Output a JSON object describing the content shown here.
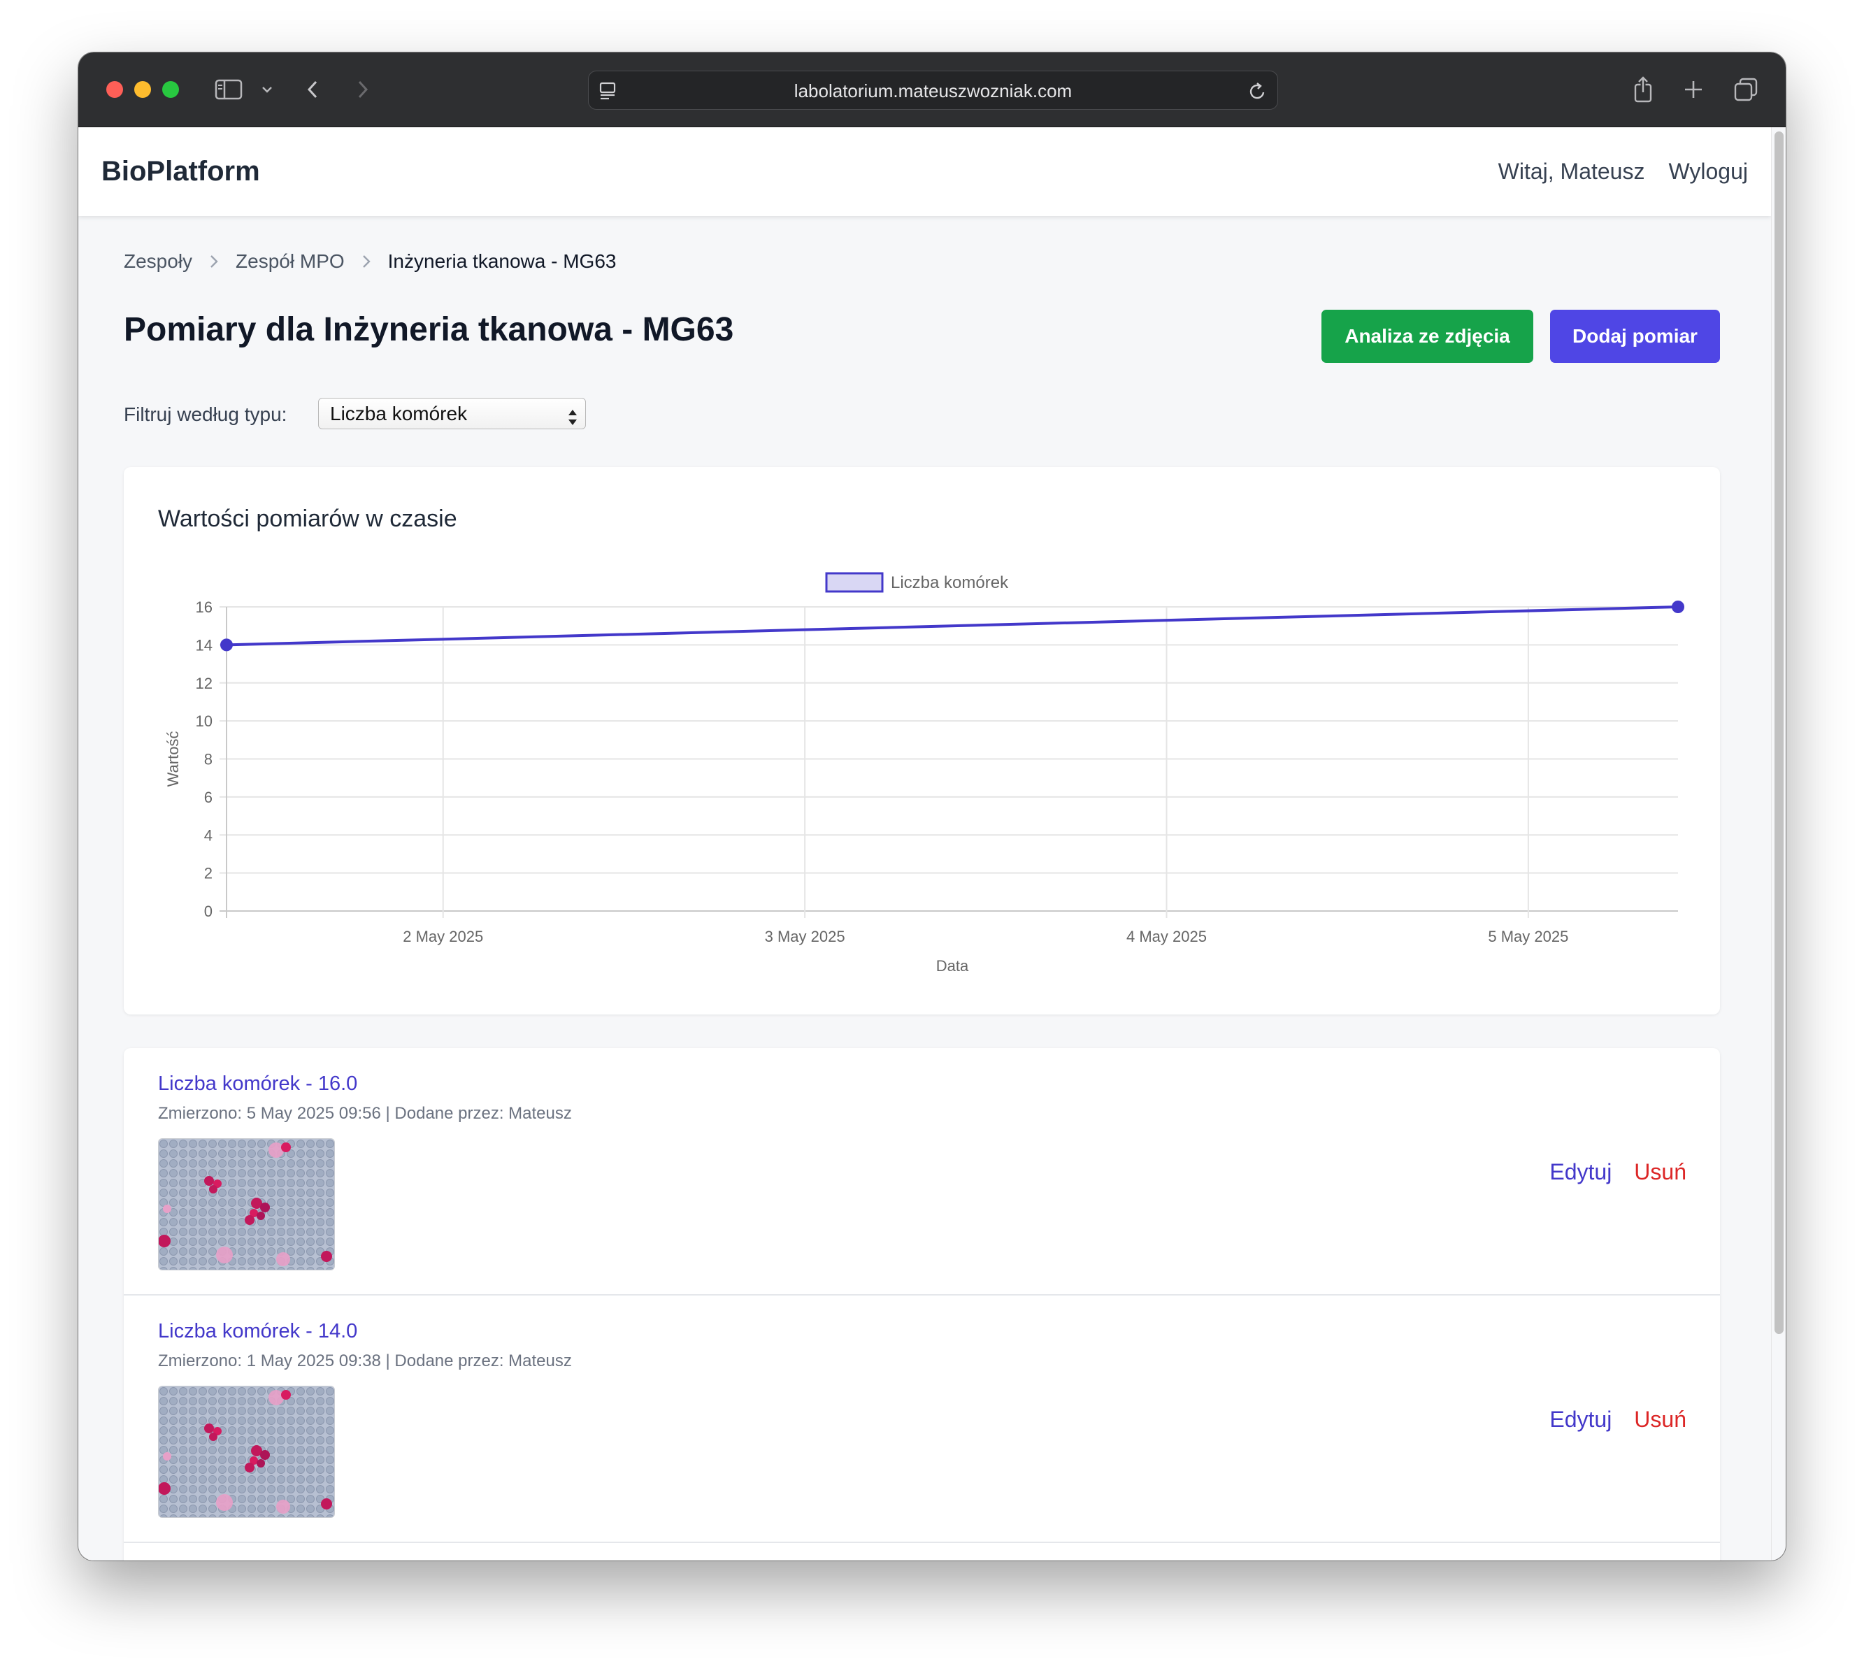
{
  "browser": {
    "url": "labolatorium.mateuszwozniak.com"
  },
  "navbar": {
    "brand": "BioPlatform",
    "greeting": "Witaj, Mateusz",
    "logout": "Wyloguj"
  },
  "breadcrumb": {
    "items": [
      "Zespoły",
      "Zespół MPO",
      "Inżyneria tkanowa - MG63"
    ]
  },
  "header": {
    "title": "Pomiary dla Inżyneria tkanowa - MG63",
    "analyze_button": "Analiza ze zdjęcia",
    "add_button": "Dodaj pomiar"
  },
  "filter": {
    "label": "Filtruj według typu:",
    "selected": "Liczba komórek"
  },
  "chart_card": {
    "title": "Wartości pomiarów w czasie"
  },
  "chart_data": {
    "type": "line",
    "title": "Wartości pomiarów w czasie",
    "xlabel": "Data",
    "ylabel": "Wartość",
    "x_ticks": [
      "2 May 2025",
      "3 May 2025",
      "4 May 2025",
      "5 May 2025"
    ],
    "y_ticks": [
      "0",
      "2",
      "4",
      "6",
      "8",
      "10",
      "12",
      "14",
      "16"
    ],
    "ylim": [
      0,
      16
    ],
    "xlim": [
      "2025-05-01T09:38",
      "2025-05-05T09:56"
    ],
    "grid": true,
    "legend_position": "top",
    "series": [
      {
        "name": "Liczba komórek",
        "color": "#4338ca",
        "points": [
          {
            "x": "2025-05-01T09:38",
            "y": 14.0
          },
          {
            "x": "2025-05-05T09:56",
            "y": 16.0
          }
        ]
      }
    ]
  },
  "measurements": [
    {
      "title": "Liczba komórek - 16.0",
      "meta": "Zmierzono: 5 May 2025 09:56 | Dodane przez: Mateusz",
      "edit": "Edytuj",
      "delete": "Usuń"
    },
    {
      "title": "Liczba komórek - 14.0",
      "meta": "Zmierzono: 1 May 2025 09:38 | Dodane przez: Mateusz",
      "edit": "Edytuj",
      "delete": "Usuń"
    }
  ]
}
